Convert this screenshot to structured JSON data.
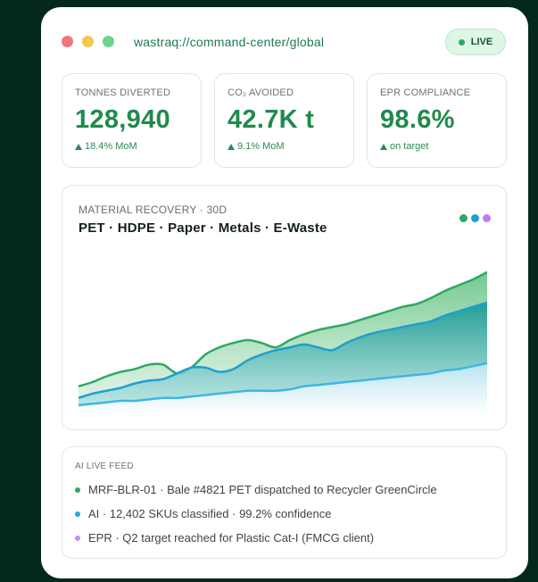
{
  "window": {
    "url": "wastraq://command-center/global",
    "live_label": "LIVE",
    "traffic_colors": [
      "#f0767a",
      "#f2ca4a",
      "#72d38f"
    ]
  },
  "stats": [
    {
      "label": "TONNES DIVERTED",
      "value": "128,940",
      "change": "18.4% MoM"
    },
    {
      "label": "CO₂ AVOIDED",
      "value": "42.7K t",
      "change": "9.1% MoM"
    },
    {
      "label": "EPR COMPLIANCE",
      "value": "98.6%",
      "change": "on target"
    }
  ],
  "chart": {
    "title": "MATERIAL RECOVERY · 30D",
    "subtitle": "PET · HDPE · Paper · Metals · E-Waste",
    "legend_colors": [
      "#2ea862",
      "#1f9fd0",
      "#c07af0"
    ]
  },
  "chart_data": {
    "type": "area",
    "title": "MATERIAL RECOVERY · 30D",
    "subtitle": "PET · HDPE · Paper · Metals · E-Waste",
    "x": [
      1,
      2,
      3,
      4,
      5,
      6,
      7,
      8,
      9,
      10,
      11,
      12,
      13,
      14,
      15,
      16,
      17,
      18,
      19,
      20,
      21,
      22,
      23,
      24,
      25,
      26,
      27,
      28,
      29,
      30
    ],
    "ylim": [
      0,
      100
    ],
    "grid": false,
    "legend": "top-right",
    "series": [
      {
        "color": "#2ea862",
        "values": [
          18,
          21,
          25,
          28,
          30,
          33,
          33,
          27,
          31,
          40,
          45,
          48,
          50,
          48,
          45,
          50,
          54,
          57,
          59,
          61,
          64,
          67,
          70,
          73,
          75,
          79,
          84,
          88,
          92,
          97
        ]
      },
      {
        "color": "#1f9fd0",
        "values": [
          10,
          13,
          15,
          17,
          20,
          22,
          23,
          27,
          31,
          31,
          28,
          30,
          36,
          40,
          43,
          45,
          47,
          45,
          43,
          48,
          52,
          55,
          57,
          59,
          61,
          63,
          67,
          70,
          73,
          76
        ]
      },
      {
        "color": "#3fb5e6",
        "values": [
          5,
          6,
          7,
          8,
          8,
          9,
          10,
          10,
          11,
          12,
          13,
          14,
          15,
          15,
          15,
          16,
          18,
          19,
          20,
          21,
          22,
          23,
          24,
          25,
          26,
          27,
          29,
          30,
          32,
          34
        ]
      }
    ]
  },
  "feed": {
    "title": "AI LIVE FEED",
    "items": [
      {
        "text": "MRF-BLR-01 · Bale #4821 PET dispatched to Recycler GreenCircle",
        "color": "#2ea862"
      },
      {
        "text": "AI · 12,402 SKUs classified · 99.2% confidence",
        "color": "#2aa4d8"
      },
      {
        "text": "EPR · Q2 target reached for Plastic Cat-I (FMCG client)",
        "color": "#c58cf2"
      }
    ]
  }
}
